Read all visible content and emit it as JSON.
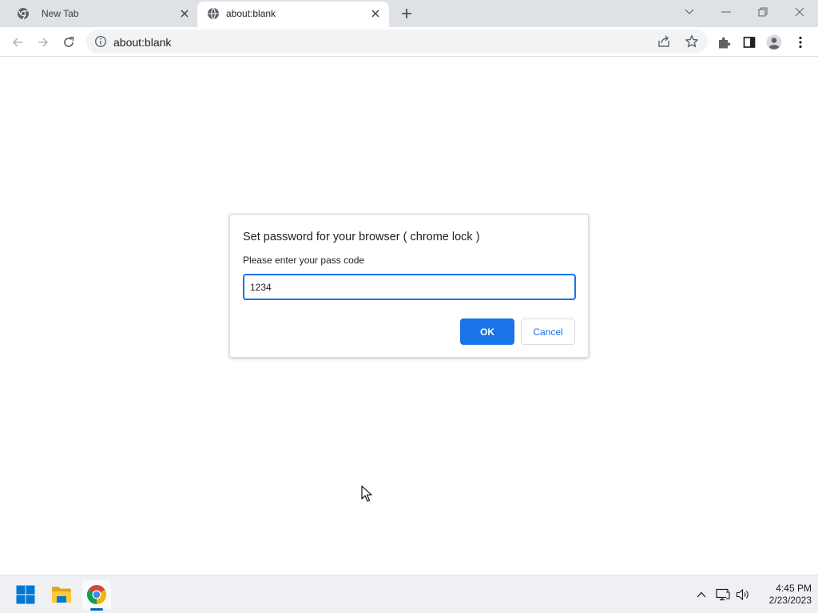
{
  "browser": {
    "tabs": [
      {
        "title": "New Tab",
        "icon": "chrome-icon",
        "active": false
      },
      {
        "title": "about:blank",
        "icon": "globe-icon",
        "active": true
      }
    ],
    "address": {
      "url": "about:blank",
      "site_info_icon": "info-icon"
    },
    "toolbar_icons": [
      "back-icon",
      "forward-icon",
      "reload-icon",
      "share-icon",
      "star-icon",
      "extensions-icon",
      "side-panel-icon",
      "profile-icon",
      "menu-icon"
    ],
    "accent_color": "#1a73e8"
  },
  "dialog": {
    "title": "Set password for your browser ( chrome lock )",
    "message": "Please enter your pass code",
    "input_value": "1234",
    "ok_label": "OK",
    "cancel_label": "Cancel"
  },
  "taskbar": {
    "apps": [
      {
        "name": "Start",
        "icon": "windows-start-icon"
      },
      {
        "name": "File Explorer",
        "icon": "folder-icon"
      },
      {
        "name": "Google Chrome",
        "icon": "chrome-icon",
        "active": true
      }
    ],
    "tray_icons": [
      "chevron-up-icon",
      "network-icon",
      "volume-icon"
    ],
    "clock": {
      "time": "4:45 PM",
      "date": "2/23/2023"
    }
  }
}
